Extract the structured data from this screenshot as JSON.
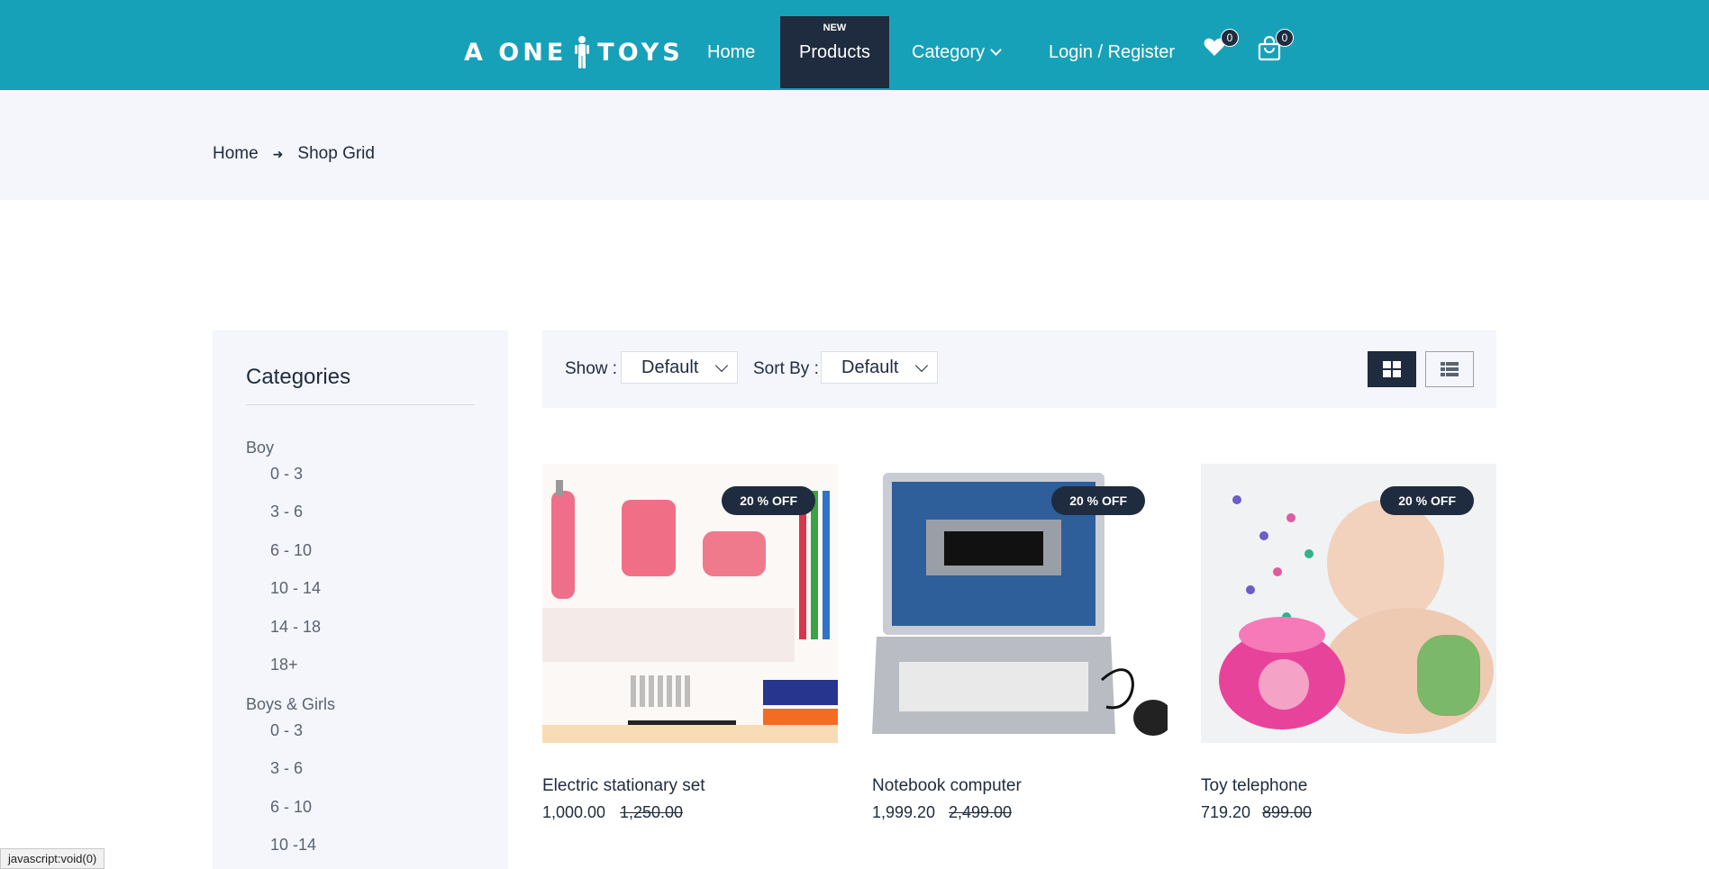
{
  "header": {
    "logo_text_left": "A ONE",
    "logo_text_right": "TOYS",
    "nav": {
      "home": "Home",
      "products": "Products",
      "products_tag": "NEW",
      "category": "Category",
      "login": "Login / Register"
    },
    "wishlist_count": "0",
    "cart_count": "0",
    "colors": {
      "bar": "#17a1b8",
      "active": "#1f2b3e"
    }
  },
  "breadcrumb": {
    "home": "Home",
    "current": "Shop Grid"
  },
  "sidebar": {
    "title": "Categories",
    "groups": [
      {
        "label": "Boy",
        "items": [
          "0 - 3",
          "3 - 6",
          "6 - 10",
          "10 - 14",
          "14 - 18",
          "18+"
        ]
      },
      {
        "label": "Boys & Girls",
        "items": [
          "0 - 3",
          "3 - 6",
          "6 - 10",
          "10 -14"
        ]
      }
    ]
  },
  "toolbar": {
    "show_label": "Show :",
    "show_value": "Default",
    "sort_label": "Sort By :",
    "sort_value": "Default"
  },
  "products": [
    {
      "name": "Electric stationary set",
      "price": "1,000.00",
      "old_price": "1,250.00",
      "badge": "20 % OFF"
    },
    {
      "name": "Notebook computer",
      "price": "1,999.20",
      "old_price": "2,499.00",
      "badge": "20 % OFF"
    },
    {
      "name": "Toy telephone",
      "price": "719.20",
      "old_price": "899.00",
      "badge": "20 % OFF"
    }
  ],
  "status_bar": "javascript:void(0)"
}
